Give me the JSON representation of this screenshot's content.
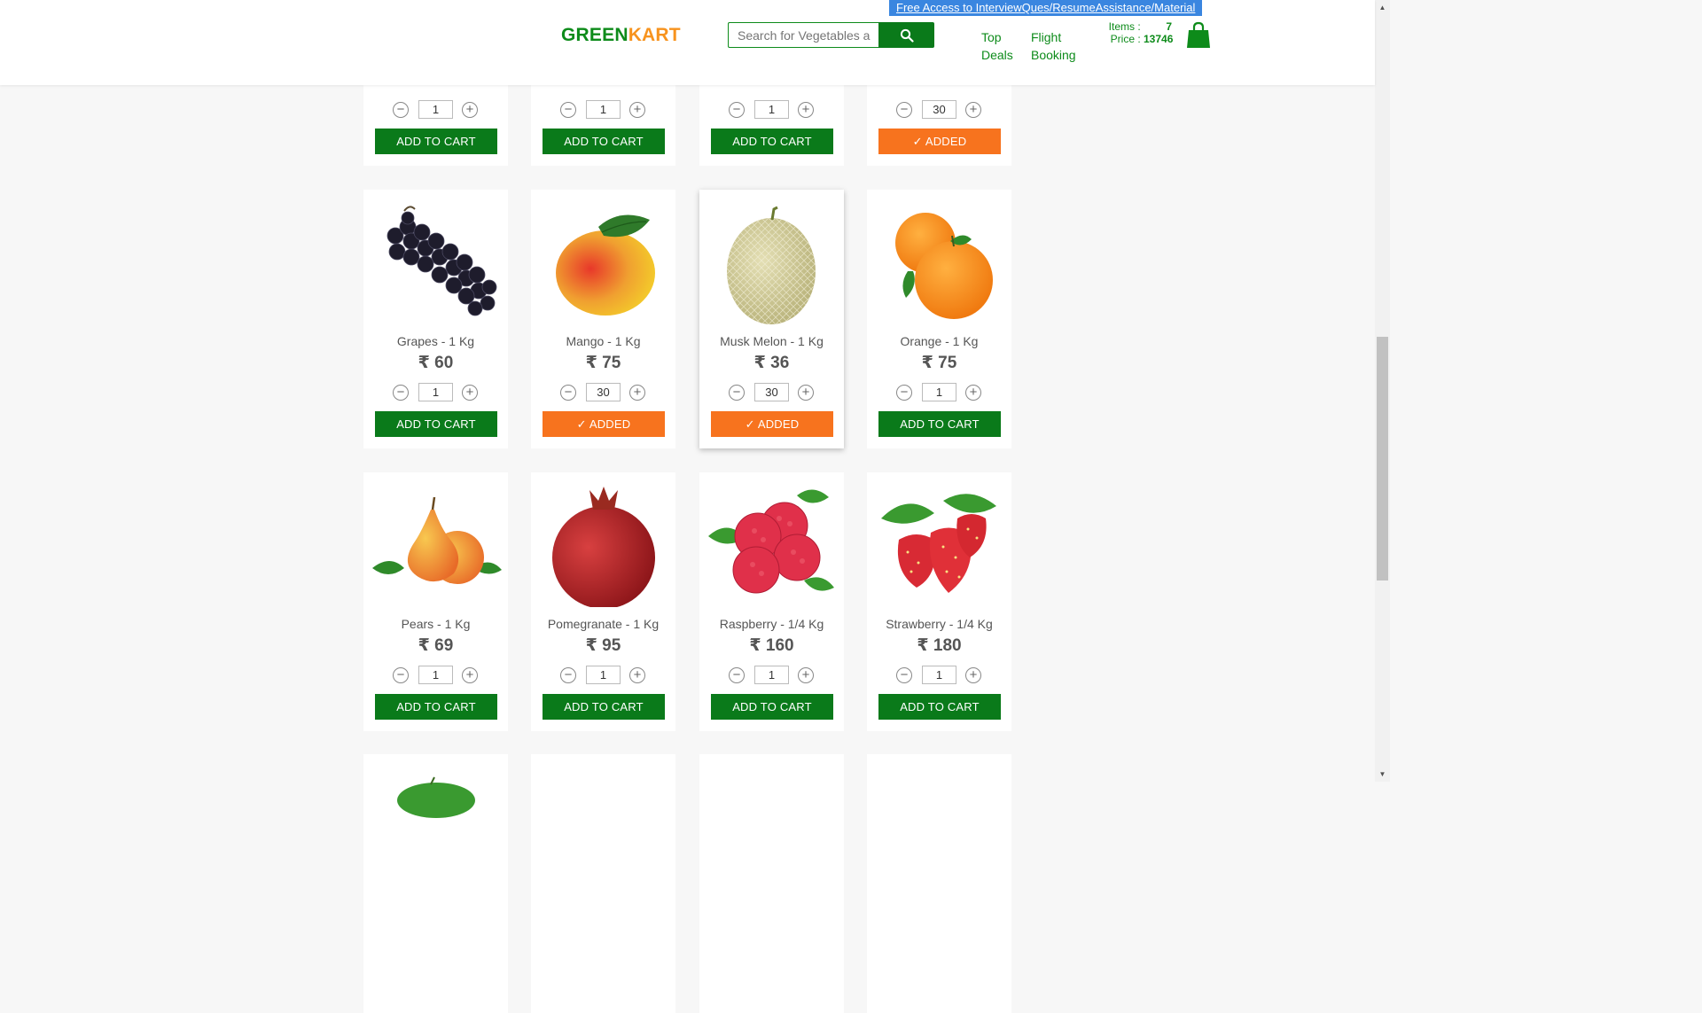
{
  "header": {
    "brand_part1": "GREEN",
    "brand_part2": "KART",
    "promo_link": "Free Access to InterviewQues/ResumeAssistance/Material",
    "search_placeholder": "Search for Vegetables and Fruits",
    "search_icon": "search-icon",
    "nav": [
      {
        "line1": "Top",
        "line2": "Deals"
      },
      {
        "line1": "Flight",
        "line2": "Booking"
      }
    ],
    "cart": {
      "items_label": "Items",
      "items_value": "7",
      "price_label": "Price",
      "price_value": "13746",
      "separator": ":",
      "icon": "shopping-bag-icon"
    }
  },
  "colors": {
    "brand_green": "#0d8b1a",
    "brand_orange": "#f7931e",
    "button_green": "#0a7a1a",
    "added_orange": "#f7731e",
    "promo_blue": "#3a86e0"
  },
  "products_row0": [
    {
      "qty": "1",
      "button": "ADD TO CART",
      "added": false
    },
    {
      "qty": "1",
      "button": "ADD TO CART",
      "added": false
    },
    {
      "qty": "1",
      "button": "ADD TO CART",
      "added": false
    },
    {
      "qty": "30",
      "button": "✓ ADDED",
      "added": true
    }
  ],
  "products": [
    {
      "name": "Grapes - 1 Kg",
      "price": "₹ 60",
      "qty": "1",
      "button": "ADD TO CART",
      "added": false,
      "image": "grapes"
    },
    {
      "name": "Mango - 1 Kg",
      "price": "₹ 75",
      "qty": "30",
      "button": "✓ ADDED",
      "added": true,
      "image": "mango"
    },
    {
      "name": "Musk Melon - 1 Kg",
      "price": "₹ 36",
      "qty": "30",
      "button": "✓ ADDED",
      "added": true,
      "image": "musk-melon"
    },
    {
      "name": "Orange - 1 Kg",
      "price": "₹ 75",
      "qty": "1",
      "button": "ADD TO CART",
      "added": false,
      "image": "orange"
    },
    {
      "name": "Pears - 1 Kg",
      "price": "₹ 69",
      "qty": "1",
      "button": "ADD TO CART",
      "added": false,
      "image": "pears"
    },
    {
      "name": "Pomegranate - 1 Kg",
      "price": "₹ 95",
      "qty": "1",
      "button": "ADD TO CART",
      "added": false,
      "image": "pomegranate"
    },
    {
      "name": "Raspberry - 1/4 Kg",
      "price": "₹ 160",
      "qty": "1",
      "button": "ADD TO CART",
      "added": false,
      "image": "raspberry"
    },
    {
      "name": "Strawberry - 1/4 Kg",
      "price": "₹ 180",
      "qty": "1",
      "button": "ADD TO CART",
      "added": false,
      "image": "strawberry"
    }
  ],
  "stepper_labels": {
    "decrement": "−",
    "increment": "+"
  }
}
